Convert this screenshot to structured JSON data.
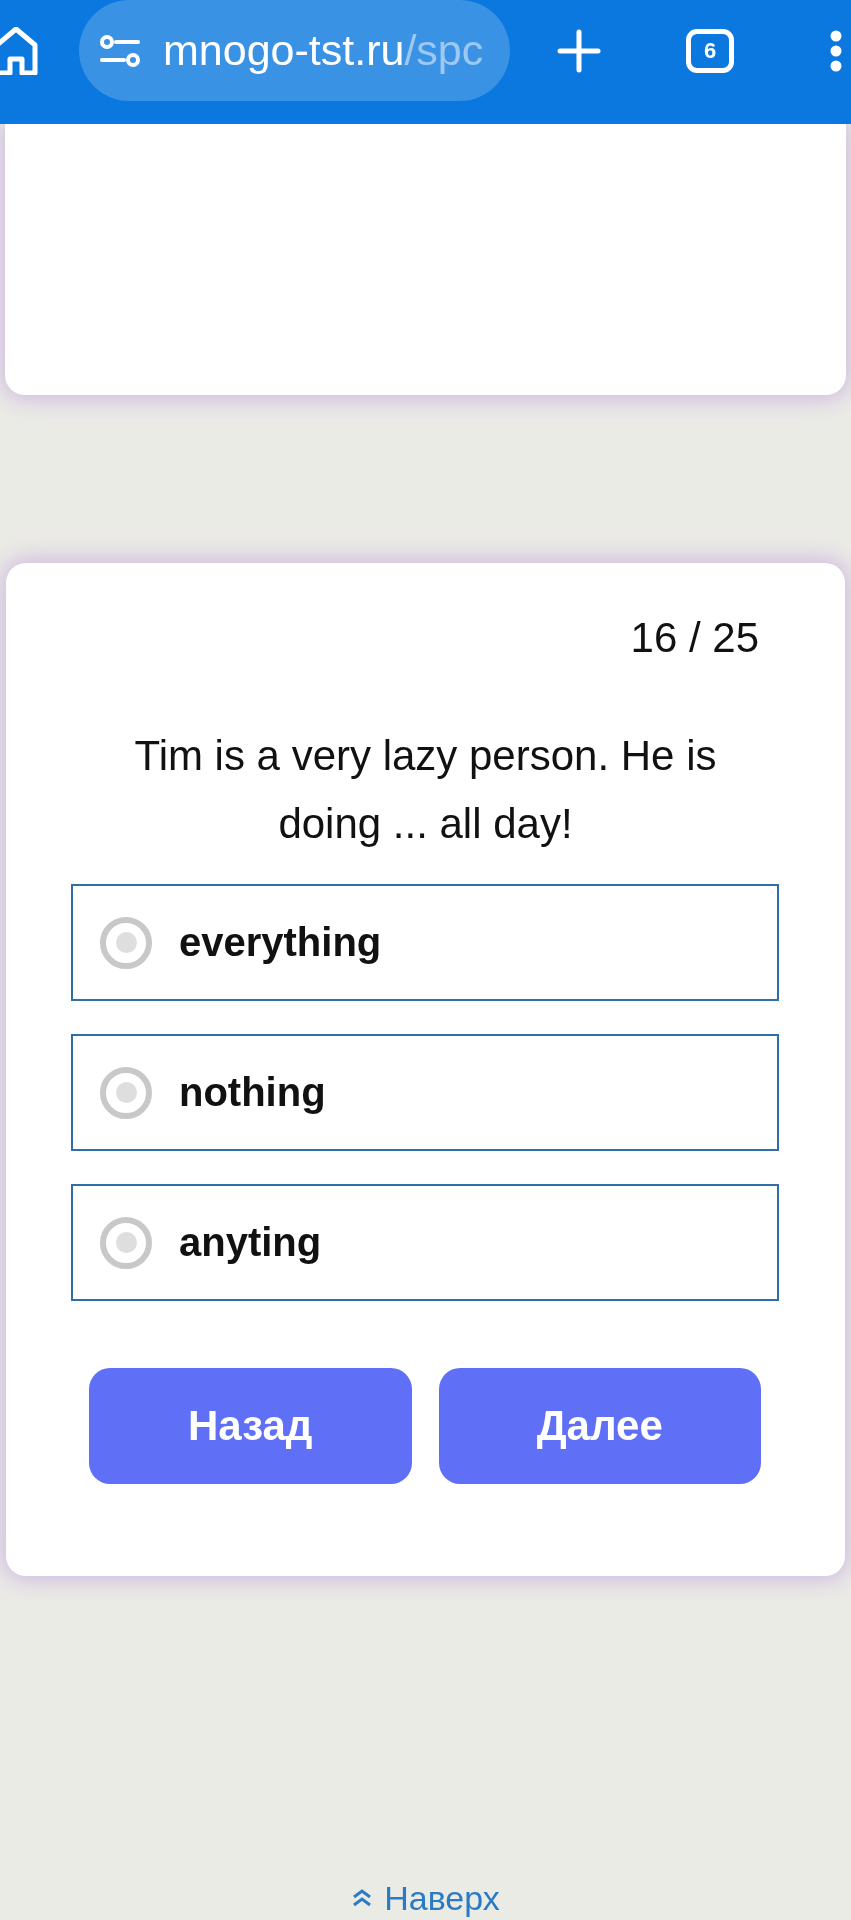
{
  "browser": {
    "url_host": "mnogo-tst.ru",
    "url_path": "/spc",
    "tab_count": "6"
  },
  "quiz": {
    "progress": "16 / 25",
    "question": "Tim is a very lazy person. He is doing ... all day!",
    "options": [
      {
        "label": "everything",
        "selected": false
      },
      {
        "label": "nothing",
        "selected": false
      },
      {
        "label": "anyting",
        "selected": false
      }
    ],
    "buttons": [
      "Назад",
      "Далее"
    ]
  },
  "footer": {
    "link": "Наверх"
  }
}
